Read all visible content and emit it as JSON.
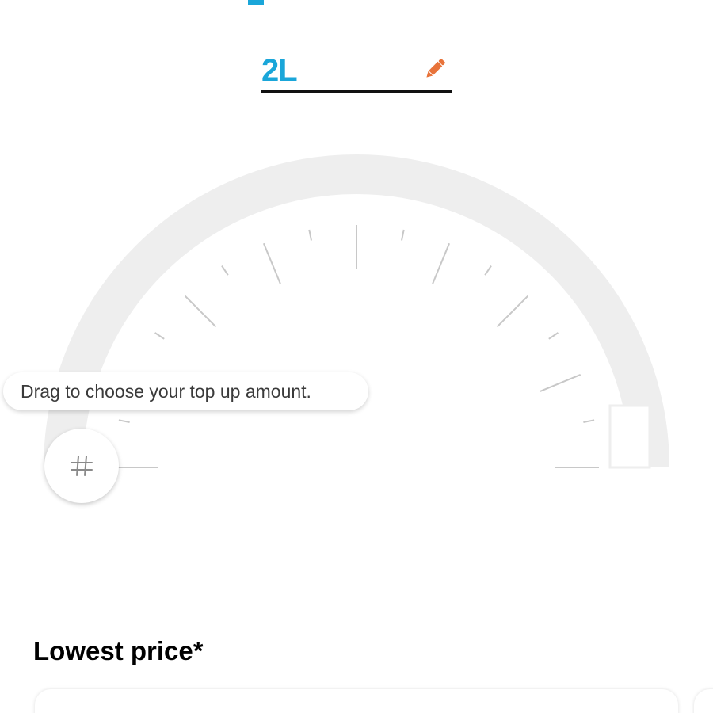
{
  "top_up": {
    "amount_label": "2L",
    "accent_color": "#1aa6d9",
    "edit_icon": "pencil-icon",
    "edit_icon_color": "#e8733a"
  },
  "dial": {
    "level": 0,
    "tooltip": "Drag to choose your top up amount.",
    "handle_icon": "hash-icon"
  },
  "offers": {
    "title": "Lowest price*"
  }
}
